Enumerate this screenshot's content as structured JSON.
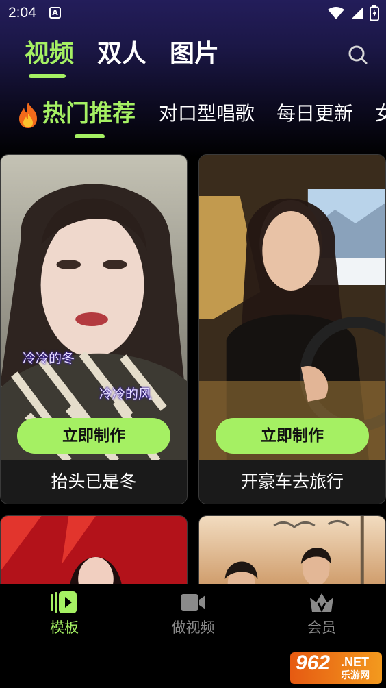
{
  "status_bar": {
    "time": "2:04",
    "notif_glyph": "A"
  },
  "main_tabs": [
    {
      "label": "视频",
      "active": true
    },
    {
      "label": "双人",
      "active": false
    },
    {
      "label": "图片",
      "active": false
    }
  ],
  "category_tabs": [
    {
      "label": "热门推荐",
      "active": true
    },
    {
      "label": "对口型唱歌",
      "active": false
    },
    {
      "label": "每日更新",
      "active": false
    },
    {
      "label": "女",
      "active": false
    }
  ],
  "cards": [
    {
      "title": "抬头已是冬",
      "button": "立即制作",
      "lyrics": [
        "冷冷的冬",
        "冷冷的风"
      ]
    },
    {
      "title": "开豪车去旅行",
      "button": "立即制作"
    }
  ],
  "bottom_nav": [
    {
      "label": "模板",
      "icon": "template-play-icon",
      "active": true
    },
    {
      "label": "做视频",
      "icon": "video-camera-icon",
      "active": false
    },
    {
      "label": "会员",
      "icon": "crown-vip-icon",
      "active": false
    }
  ],
  "watermark": {
    "number": "962",
    "net": ".NET",
    "sub": "乐游网"
  },
  "colors": {
    "accent": "#a5f063",
    "background": "#000000",
    "header_gradient_top": "#231d5a"
  }
}
